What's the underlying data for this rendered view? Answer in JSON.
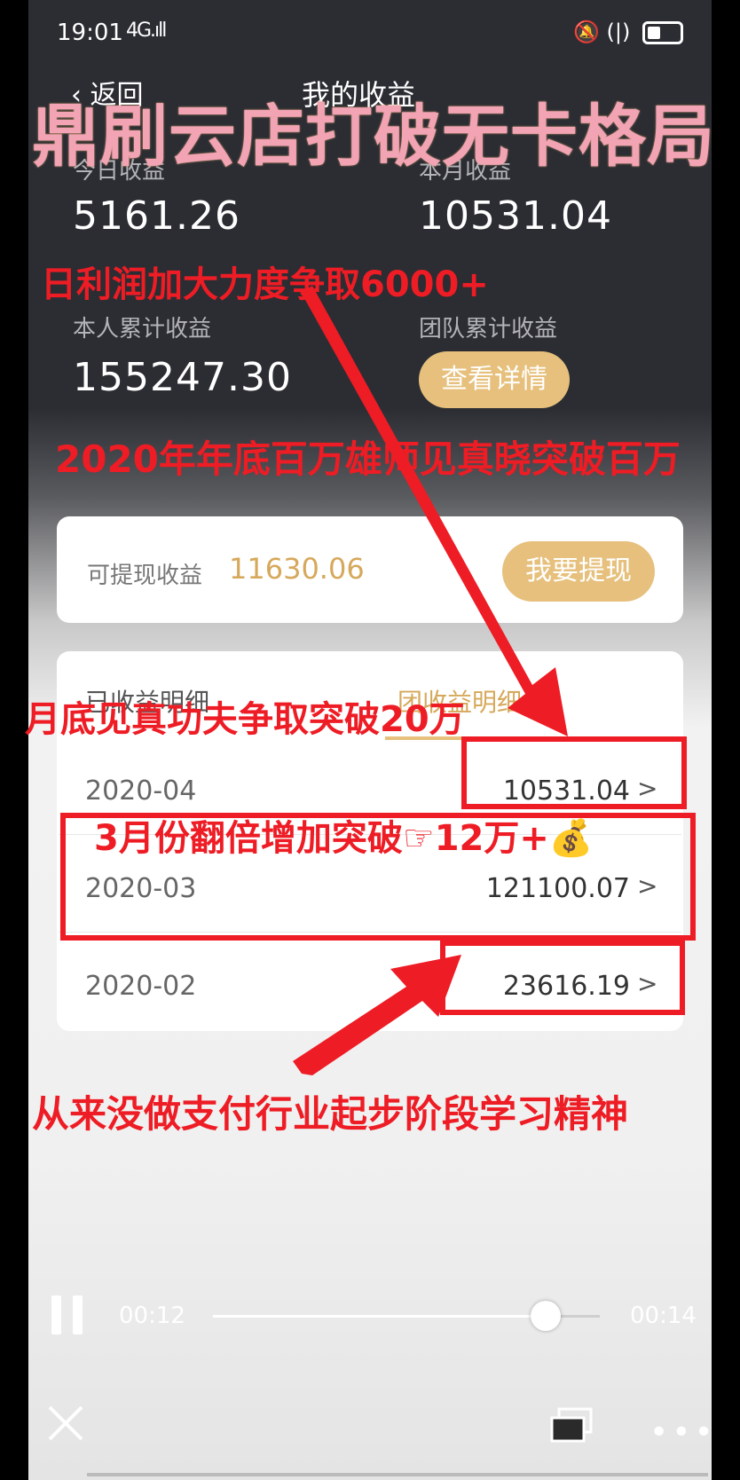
{
  "status": {
    "time": "19:01",
    "signal": "4G.ıll",
    "right_icons": "🔕 (|)"
  },
  "nav": {
    "back": "‹ 返回",
    "title": "我的收益"
  },
  "stats": {
    "today_label": "今日收益",
    "today_value": "5161.26",
    "month_label": "本月收益",
    "month_value": "10531.04",
    "personal_label": "本人累计收益",
    "personal_value": "155247.30",
    "team_label": "团队累计收益",
    "team_button": "查看详情"
  },
  "withdraw": {
    "label": "可提现收益",
    "value": "11630.06",
    "button": "我要提现"
  },
  "tabs": {
    "left": "已收益明细",
    "right": "团收益明细"
  },
  "rows": [
    {
      "date": "2020-04",
      "value": "10531.04",
      "chevron": ">"
    },
    {
      "date": "2020-03",
      "value": "121100.07",
      "chevron": ">"
    },
    {
      "date": "2020-02",
      "value": "23616.19",
      "chevron": ">"
    }
  ],
  "annotations": {
    "title": "鼎刷云店打破无卡格局",
    "a1": "日利润加大力度争取6000+",
    "a2": "2020年年底百万雄师见真晓突破百万",
    "a3": "月底见真功夫争取突破20万",
    "a4": "3月份翻倍增加突破☞12万+💰",
    "a5": "从来没做支付行业起步阶段学习精神"
  },
  "player": {
    "current": "00:12",
    "total": "00:14",
    "progress": 0.86
  },
  "colors": {
    "accent": "#e6c07c",
    "annotation_red": "#ee1c24",
    "title_pink": "#f2a3b4"
  }
}
